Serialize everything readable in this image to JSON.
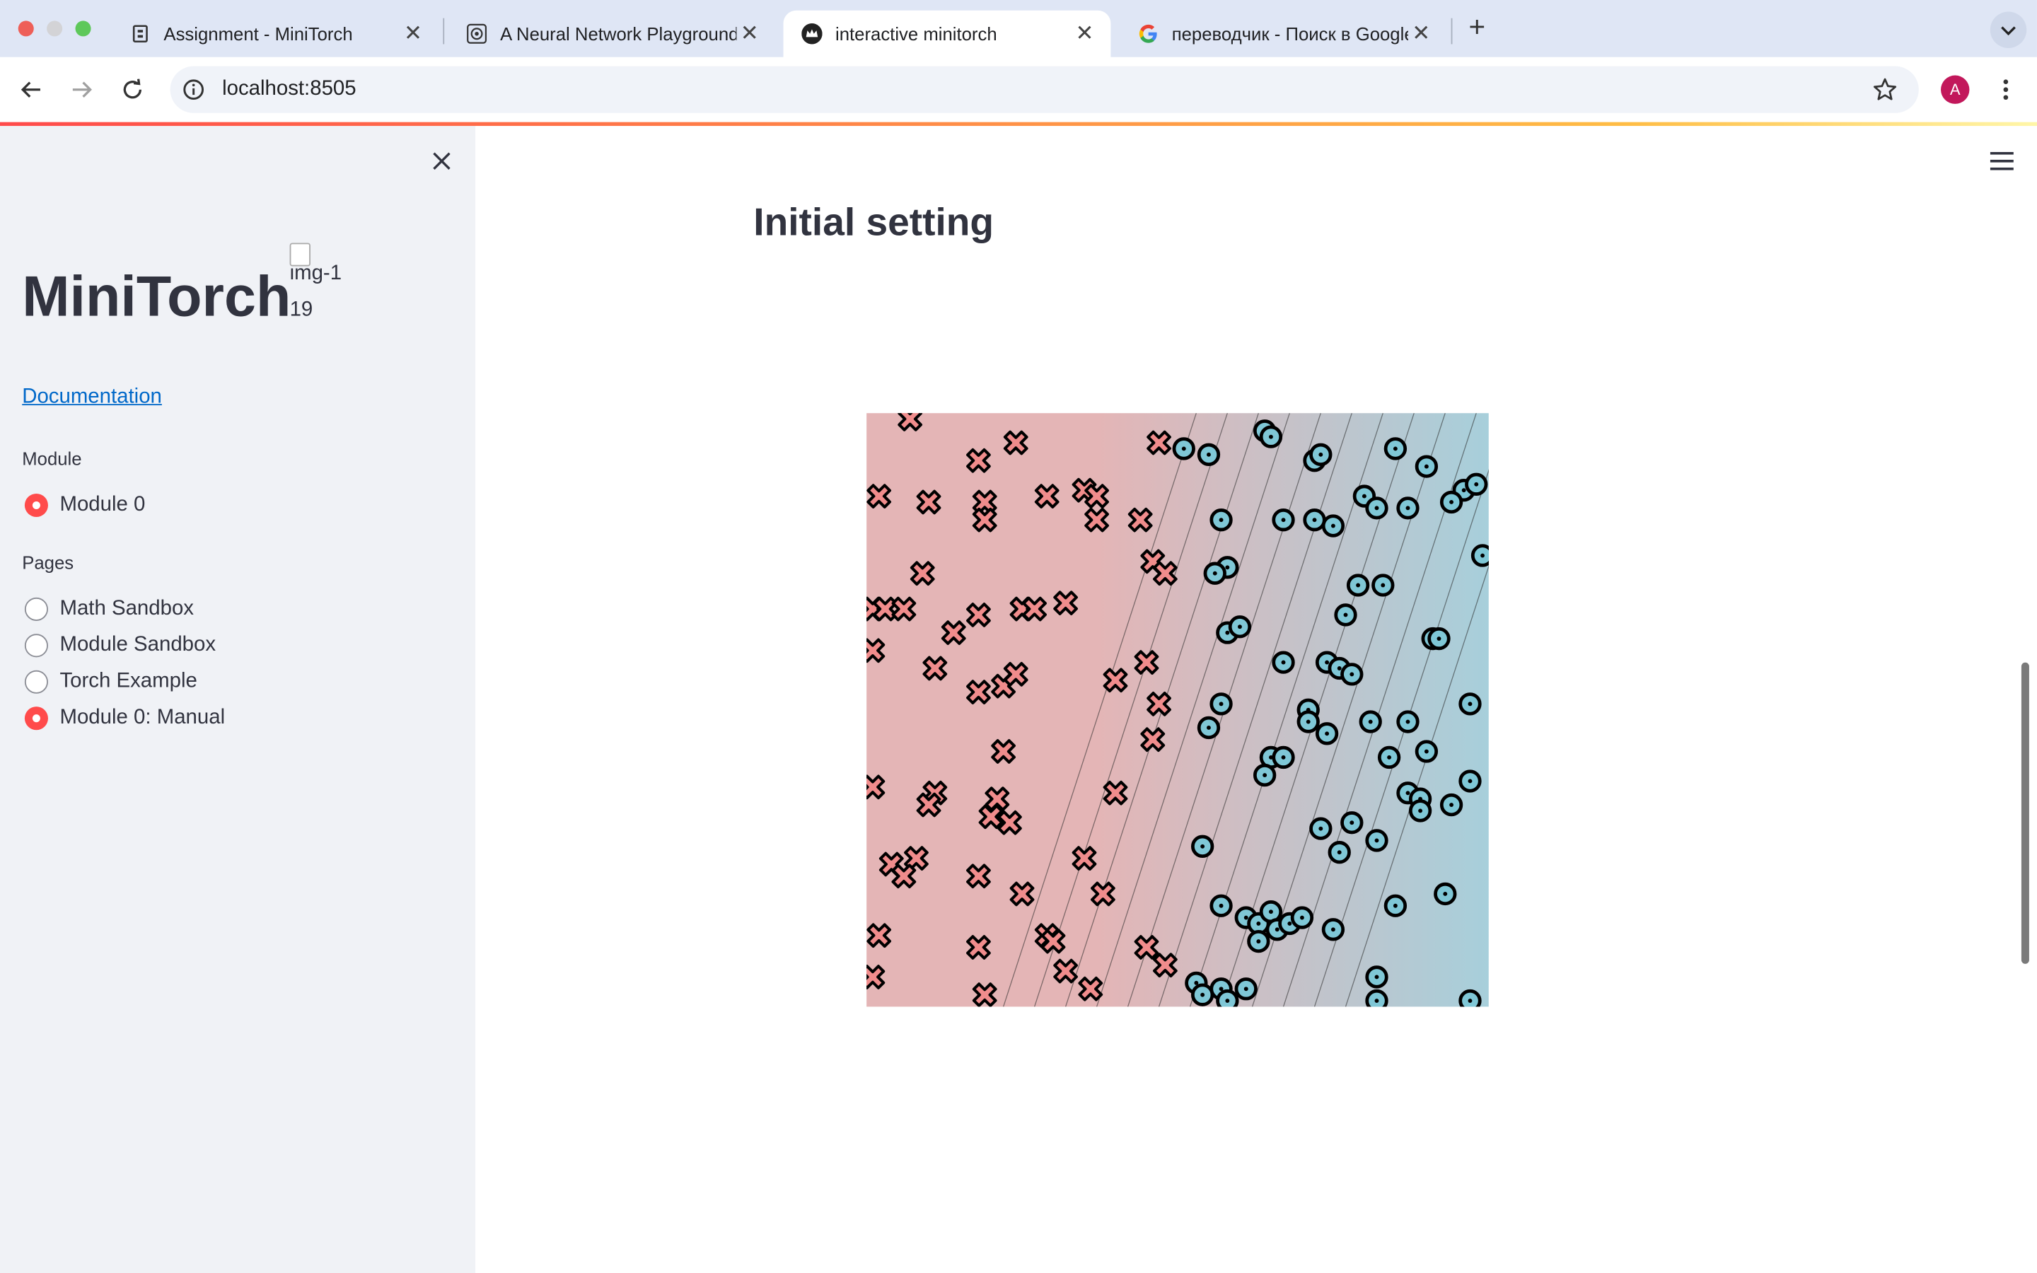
{
  "browser": {
    "tabs": [
      {
        "title": "Assignment - MiniTorch",
        "icon": "minitorch-doc-icon",
        "active": false
      },
      {
        "title": "A Neural Network Playground",
        "icon": "playground-icon",
        "active": false
      },
      {
        "title": "interactive minitorch",
        "icon": "streamlit-crown-icon",
        "active": true
      },
      {
        "title": "переводчик - Поиск в Google",
        "icon": "google-icon",
        "active": false
      }
    ],
    "url": "localhost:8505",
    "avatar_letter": "A"
  },
  "sidebar": {
    "title": "MiniTorch",
    "image_alt": "img-119",
    "doc_link": "Documentation",
    "module_label": "Module",
    "module_options": [
      {
        "label": "Module 0",
        "selected": true
      }
    ],
    "pages_label": "Pages",
    "pages": [
      {
        "label": "Math Sandbox",
        "selected": false
      },
      {
        "label": "Module Sandbox",
        "selected": false
      },
      {
        "label": "Torch Example",
        "selected": false
      },
      {
        "label": "Module 0: Manual",
        "selected": true
      }
    ]
  },
  "main": {
    "heading": "Initial setting"
  },
  "colors": {
    "accent": "#ff4b4b",
    "class_x_fill": "#f08c8c",
    "class_o_fill": "#7fc7d6",
    "region_red": "#e4b5b6",
    "region_blue": "#a7cfdb",
    "link": "#0068c9"
  },
  "chart_data": {
    "type": "scatter",
    "title": "",
    "xlabel": "",
    "ylabel": "",
    "xlim": [
      0,
      1
    ],
    "ylim": [
      0,
      1
    ],
    "grid": false,
    "background": "gradient decision field, red (left) to blue (right), with diagonal contour lines",
    "series": [
      {
        "marker": "x",
        "points": [
          [
            0.07,
            0.99
          ],
          [
            0.18,
            0.92
          ],
          [
            0.24,
            0.95
          ],
          [
            0.02,
            0.86
          ],
          [
            0.1,
            0.85
          ],
          [
            0.19,
            0.85
          ],
          [
            0.19,
            0.82
          ],
          [
            0.29,
            0.86
          ],
          [
            0.35,
            0.87
          ],
          [
            0.37,
            0.86
          ],
          [
            0.37,
            0.82
          ],
          [
            0.44,
            0.82
          ],
          [
            0.47,
            0.95
          ],
          [
            0.09,
            0.73
          ],
          [
            0.01,
            0.67
          ],
          [
            0.03,
            0.67
          ],
          [
            0.06,
            0.67
          ],
          [
            0.14,
            0.63
          ],
          [
            0.18,
            0.66
          ],
          [
            0.25,
            0.67
          ],
          [
            0.27,
            0.67
          ],
          [
            0.32,
            0.68
          ],
          [
            0.01,
            0.6
          ],
          [
            0.11,
            0.57
          ],
          [
            0.18,
            0.53
          ],
          [
            0.22,
            0.54
          ],
          [
            0.24,
            0.56
          ],
          [
            0.4,
            0.55
          ],
          [
            0.45,
            0.58
          ],
          [
            0.46,
            0.75
          ],
          [
            0.48,
            0.73
          ],
          [
            0.47,
            0.51
          ],
          [
            0.46,
            0.45
          ],
          [
            0.22,
            0.43
          ],
          [
            0.01,
            0.37
          ],
          [
            0.11,
            0.36
          ],
          [
            0.1,
            0.34
          ],
          [
            0.21,
            0.35
          ],
          [
            0.2,
            0.32
          ],
          [
            0.23,
            0.31
          ],
          [
            0.4,
            0.36
          ],
          [
            0.08,
            0.25
          ],
          [
            0.04,
            0.24
          ],
          [
            0.06,
            0.22
          ],
          [
            0.18,
            0.22
          ],
          [
            0.25,
            0.19
          ],
          [
            0.35,
            0.25
          ],
          [
            0.38,
            0.19
          ],
          [
            0.02,
            0.12
          ],
          [
            0.18,
            0.1
          ],
          [
            0.29,
            0.12
          ],
          [
            0.3,
            0.11
          ],
          [
            0.32,
            0.06
          ],
          [
            0.36,
            0.03
          ],
          [
            0.45,
            0.1
          ],
          [
            0.48,
            0.07
          ],
          [
            0.01,
            0.05
          ],
          [
            0.19,
            0.02
          ]
        ]
      },
      {
        "marker": "o",
        "points": [
          [
            0.51,
            0.94
          ],
          [
            0.55,
            0.93
          ],
          [
            0.64,
            0.97
          ],
          [
            0.65,
            0.96
          ],
          [
            0.72,
            0.92
          ],
          [
            0.73,
            0.93
          ],
          [
            0.85,
            0.94
          ],
          [
            0.9,
            0.91
          ],
          [
            0.96,
            0.87
          ],
          [
            0.98,
            0.88
          ],
          [
            0.57,
            0.82
          ],
          [
            0.67,
            0.82
          ],
          [
            0.72,
            0.82
          ],
          [
            0.75,
            0.81
          ],
          [
            0.8,
            0.86
          ],
          [
            0.82,
            0.84
          ],
          [
            0.87,
            0.84
          ],
          [
            0.94,
            0.85
          ],
          [
            0.58,
            0.74
          ],
          [
            0.56,
            0.73
          ],
          [
            0.99,
            0.76
          ],
          [
            0.79,
            0.71
          ],
          [
            0.83,
            0.71
          ],
          [
            0.58,
            0.63
          ],
          [
            0.6,
            0.64
          ],
          [
            0.77,
            0.66
          ],
          [
            0.91,
            0.62
          ],
          [
            0.92,
            0.62
          ],
          [
            0.67,
            0.58
          ],
          [
            0.74,
            0.58
          ],
          [
            0.76,
            0.57
          ],
          [
            0.78,
            0.56
          ],
          [
            0.57,
            0.51
          ],
          [
            0.55,
            0.47
          ],
          [
            0.71,
            0.5
          ],
          [
            0.71,
            0.48
          ],
          [
            0.74,
            0.46
          ],
          [
            0.81,
            0.48
          ],
          [
            0.87,
            0.48
          ],
          [
            0.97,
            0.51
          ],
          [
            0.65,
            0.42
          ],
          [
            0.67,
            0.42
          ],
          [
            0.64,
            0.39
          ],
          [
            0.84,
            0.42
          ],
          [
            0.9,
            0.43
          ],
          [
            0.87,
            0.36
          ],
          [
            0.89,
            0.35
          ],
          [
            0.89,
            0.33
          ],
          [
            0.94,
            0.34
          ],
          [
            0.97,
            0.38
          ],
          [
            0.73,
            0.3
          ],
          [
            0.78,
            0.31
          ],
          [
            0.82,
            0.28
          ],
          [
            0.76,
            0.26
          ],
          [
            0.54,
            0.27
          ],
          [
            0.57,
            0.17
          ],
          [
            0.61,
            0.15
          ],
          [
            0.63,
            0.14
          ],
          [
            0.65,
            0.16
          ],
          [
            0.63,
            0.11
          ],
          [
            0.66,
            0.13
          ],
          [
            0.68,
            0.14
          ],
          [
            0.7,
            0.15
          ],
          [
            0.75,
            0.13
          ],
          [
            0.85,
            0.17
          ],
          [
            0.93,
            0.19
          ],
          [
            0.53,
            0.04
          ],
          [
            0.54,
            0.02
          ],
          [
            0.57,
            0.03
          ],
          [
            0.58,
            0.01
          ],
          [
            0.61,
            0.03
          ],
          [
            0.82,
            0.05
          ],
          [
            0.82,
            0.01
          ],
          [
            0.97,
            0.01
          ]
        ]
      }
    ]
  }
}
